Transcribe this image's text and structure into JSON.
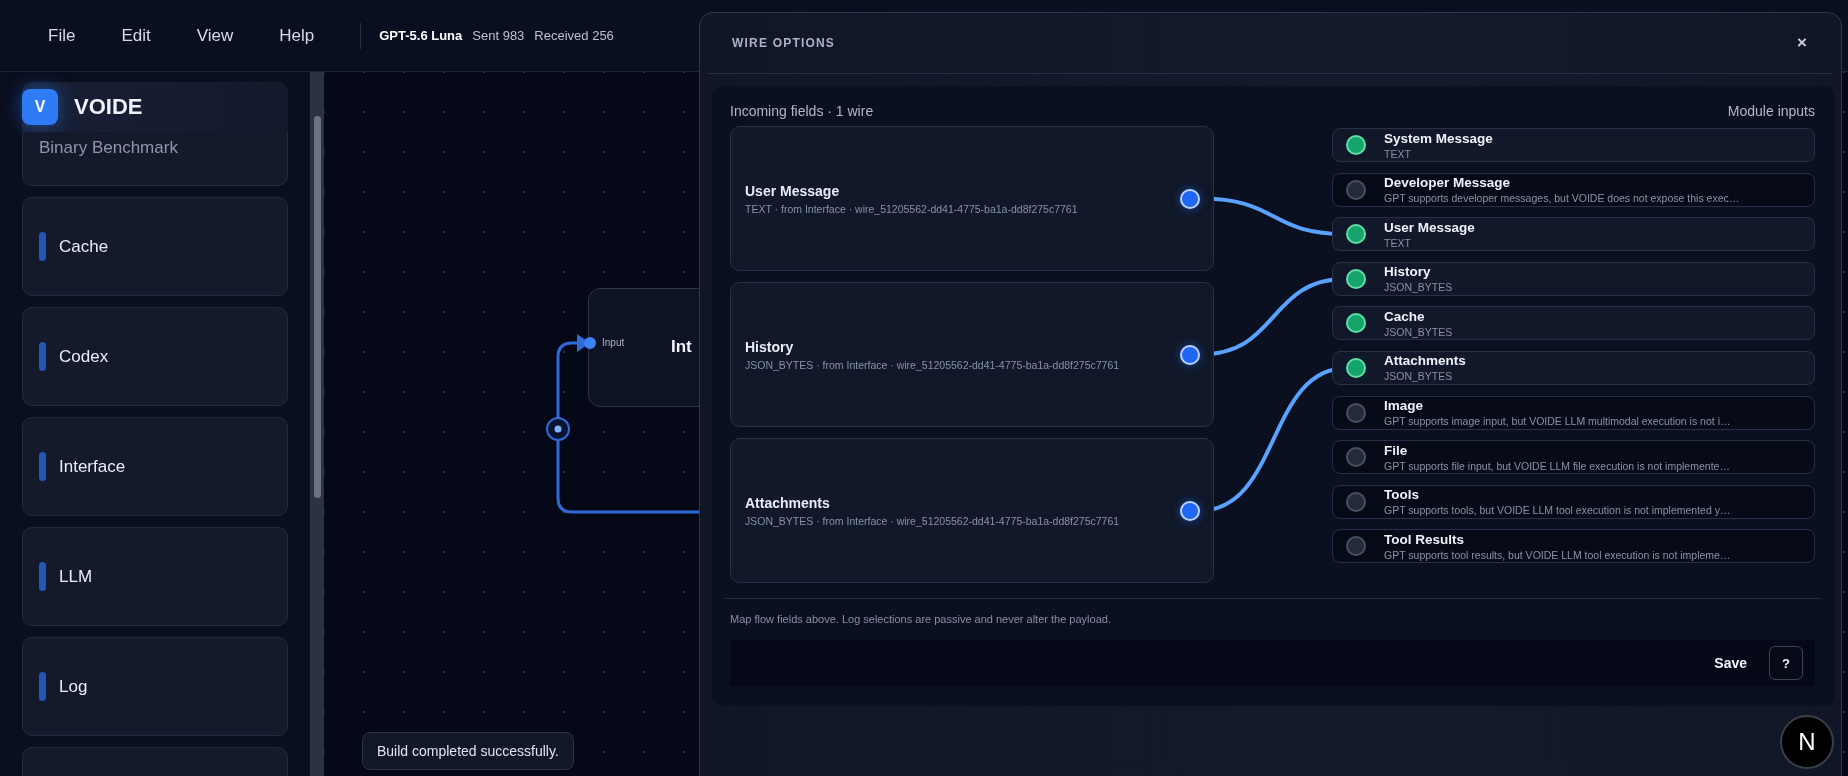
{
  "menu": [
    {
      "label": "File"
    },
    {
      "label": "Edit"
    },
    {
      "label": "View"
    },
    {
      "label": "Help"
    }
  ],
  "status": {
    "model": "GPT-5.6 Luna",
    "sent": "Sent 983",
    "received": "Received 256"
  },
  "sidebar": {
    "brand": {
      "logo": "V",
      "name": "VOIDE"
    },
    "modules": [
      {
        "label": "Binary Benchmark",
        "faded": true
      },
      {
        "label": "Cache",
        "faded": false
      },
      {
        "label": "Codex",
        "faded": false
      },
      {
        "label": "Interface",
        "faded": false
      },
      {
        "label": "LLM",
        "faded": false
      },
      {
        "label": "Log",
        "faded": false
      }
    ]
  },
  "canvas": {
    "node": {
      "title": "Int",
      "port": "Input"
    },
    "toast": "Build completed successfully."
  },
  "dialog": {
    "title": "WIRE OPTIONS",
    "close": "×",
    "incoming_heading": "Incoming fields · 1 wire",
    "inputs_heading": "Module inputs",
    "incoming_fields": [
      {
        "name": "User Message",
        "detail": "TEXT · from Interface · wire_51205562-dd41-4775-ba1a-dd8f275c7761"
      },
      {
        "name": "History",
        "detail": "JSON_BYTES · from Interface · wire_51205562-dd41-4775-ba1a-dd8f275c7761"
      },
      {
        "name": "Attachments",
        "detail": "JSON_BYTES · from Interface · wire_51205562-dd41-4775-ba1a-dd8f275c7761"
      }
    ],
    "module_inputs": [
      {
        "name": "System Message",
        "detail": "TEXT",
        "supported": true,
        "wired": false
      },
      {
        "name": "Developer Message",
        "detail": "GPT supports developer messages, but VOIDE does not expose this exec…",
        "supported": false,
        "wired": false
      },
      {
        "name": "User Message",
        "detail": "TEXT",
        "supported": true,
        "wired": true
      },
      {
        "name": "History",
        "detail": "JSON_BYTES",
        "supported": true,
        "wired": true
      },
      {
        "name": "Cache",
        "detail": "JSON_BYTES",
        "supported": true,
        "wired": false
      },
      {
        "name": "Attachments",
        "detail": "JSON_BYTES",
        "supported": true,
        "wired": true
      },
      {
        "name": "Image",
        "detail": "GPT supports image input, but VOIDE LLM multimodal execution is not i…",
        "supported": false,
        "wired": false
      },
      {
        "name": "File",
        "detail": "GPT supports file input, but VOIDE LLM file execution is not implemente…",
        "supported": false,
        "wired": false
      },
      {
        "name": "Tools",
        "detail": "GPT supports tools, but VOIDE LLM tool execution is not implemented y…",
        "supported": false,
        "wired": false
      },
      {
        "name": "Tool Results",
        "detail": "GPT supports tool results, but VOIDE LLM tool execution is not impleme…",
        "supported": false,
        "wired": false
      }
    ],
    "note": "Map flow fields above. Log selections are passive and never alter the payload.",
    "save": "Save",
    "help": "?"
  },
  "dev_badge": "N"
}
